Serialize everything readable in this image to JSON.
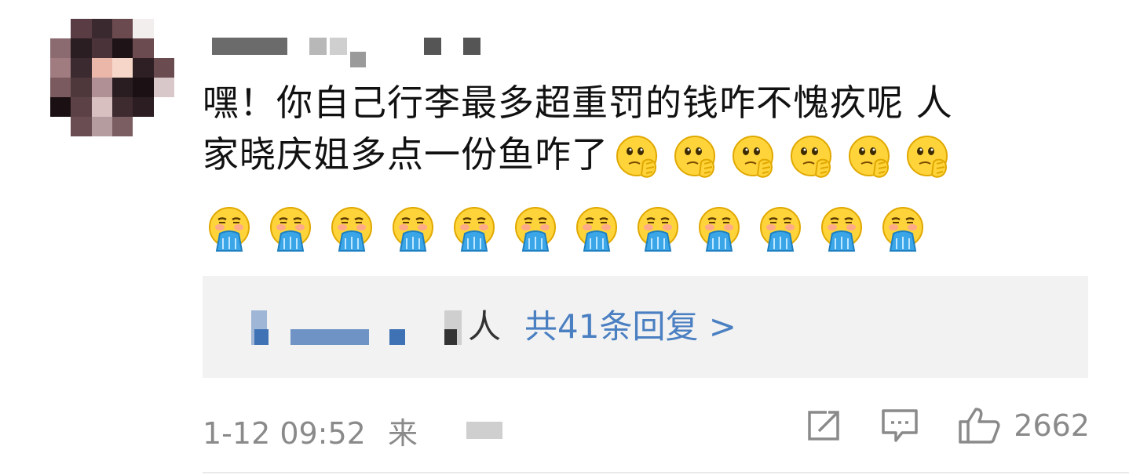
{
  "comment": {
    "line1": "嘿！你自己行李最多超重罚的钱咋不愧疚呢 人",
    "line2": "家晓庆姐多点一份鱼咋了",
    "emojis_row1": {
      "icon": "thinking-face-emoji",
      "count": 6
    },
    "emojis_row2": {
      "icon": "vomiting-face-emoji",
      "count": 12
    }
  },
  "replies": {
    "suffix": "人",
    "link_text": "共41条回复 >"
  },
  "footer": {
    "timestamp": "1-12 09:52",
    "location_partial": "来",
    "like_count": "2662"
  },
  "colors": {
    "link": "#4a7fc1",
    "text": "#111111",
    "meta": "#8a8a8a",
    "reply_bg": "#f2f2f2"
  }
}
